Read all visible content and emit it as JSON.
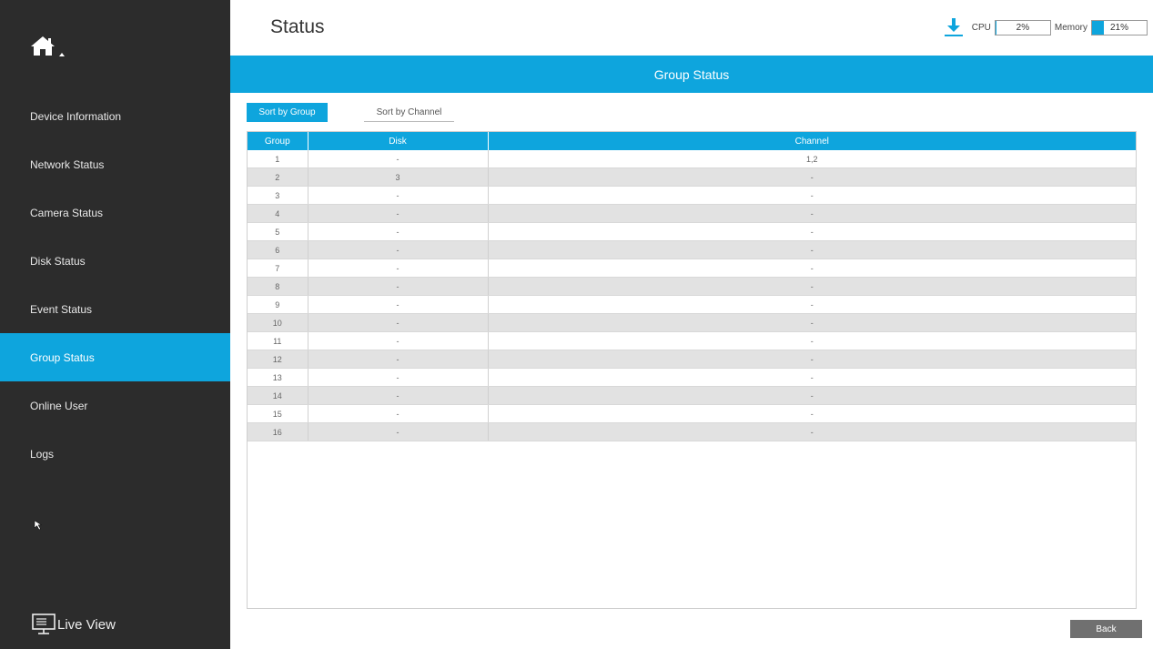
{
  "header": {
    "title": "Status",
    "cpu_label": "CPU",
    "cpu_value": "2%",
    "cpu_fraction": 0.02,
    "memory_label": "Memory",
    "memory_value": "21%",
    "memory_fraction": 0.21,
    "accent_color": "#0ea5dd"
  },
  "sidebar": {
    "items": [
      {
        "label": "Device Information",
        "active": false
      },
      {
        "label": "Network Status",
        "active": false
      },
      {
        "label": "Camera Status",
        "active": false
      },
      {
        "label": "Disk Status",
        "active": false
      },
      {
        "label": "Event Status",
        "active": false
      },
      {
        "label": "Group Status",
        "active": true
      },
      {
        "label": "Online User",
        "active": false
      },
      {
        "label": "Logs",
        "active": false
      }
    ],
    "live_view_label": "Live View"
  },
  "main": {
    "section_title": "Group Status",
    "tabs": [
      {
        "label": "Sort by Group",
        "active": true
      },
      {
        "label": "Sort by Channel",
        "active": false
      }
    ],
    "table": {
      "columns": [
        "Group",
        "Disk",
        "Channel"
      ],
      "rows": [
        [
          "1",
          "-",
          "1,2"
        ],
        [
          "2",
          "3",
          "-"
        ],
        [
          "3",
          "-",
          "-"
        ],
        [
          "4",
          "-",
          "-"
        ],
        [
          "5",
          "-",
          "-"
        ],
        [
          "6",
          "-",
          "-"
        ],
        [
          "7",
          "-",
          "-"
        ],
        [
          "8",
          "-",
          "-"
        ],
        [
          "9",
          "-",
          "-"
        ],
        [
          "10",
          "-",
          "-"
        ],
        [
          "11",
          "-",
          "-"
        ],
        [
          "12",
          "-",
          "-"
        ],
        [
          "13",
          "-",
          "-"
        ],
        [
          "14",
          "-",
          "-"
        ],
        [
          "15",
          "-",
          "-"
        ],
        [
          "16",
          "-",
          "-"
        ]
      ]
    },
    "back_label": "Back"
  }
}
